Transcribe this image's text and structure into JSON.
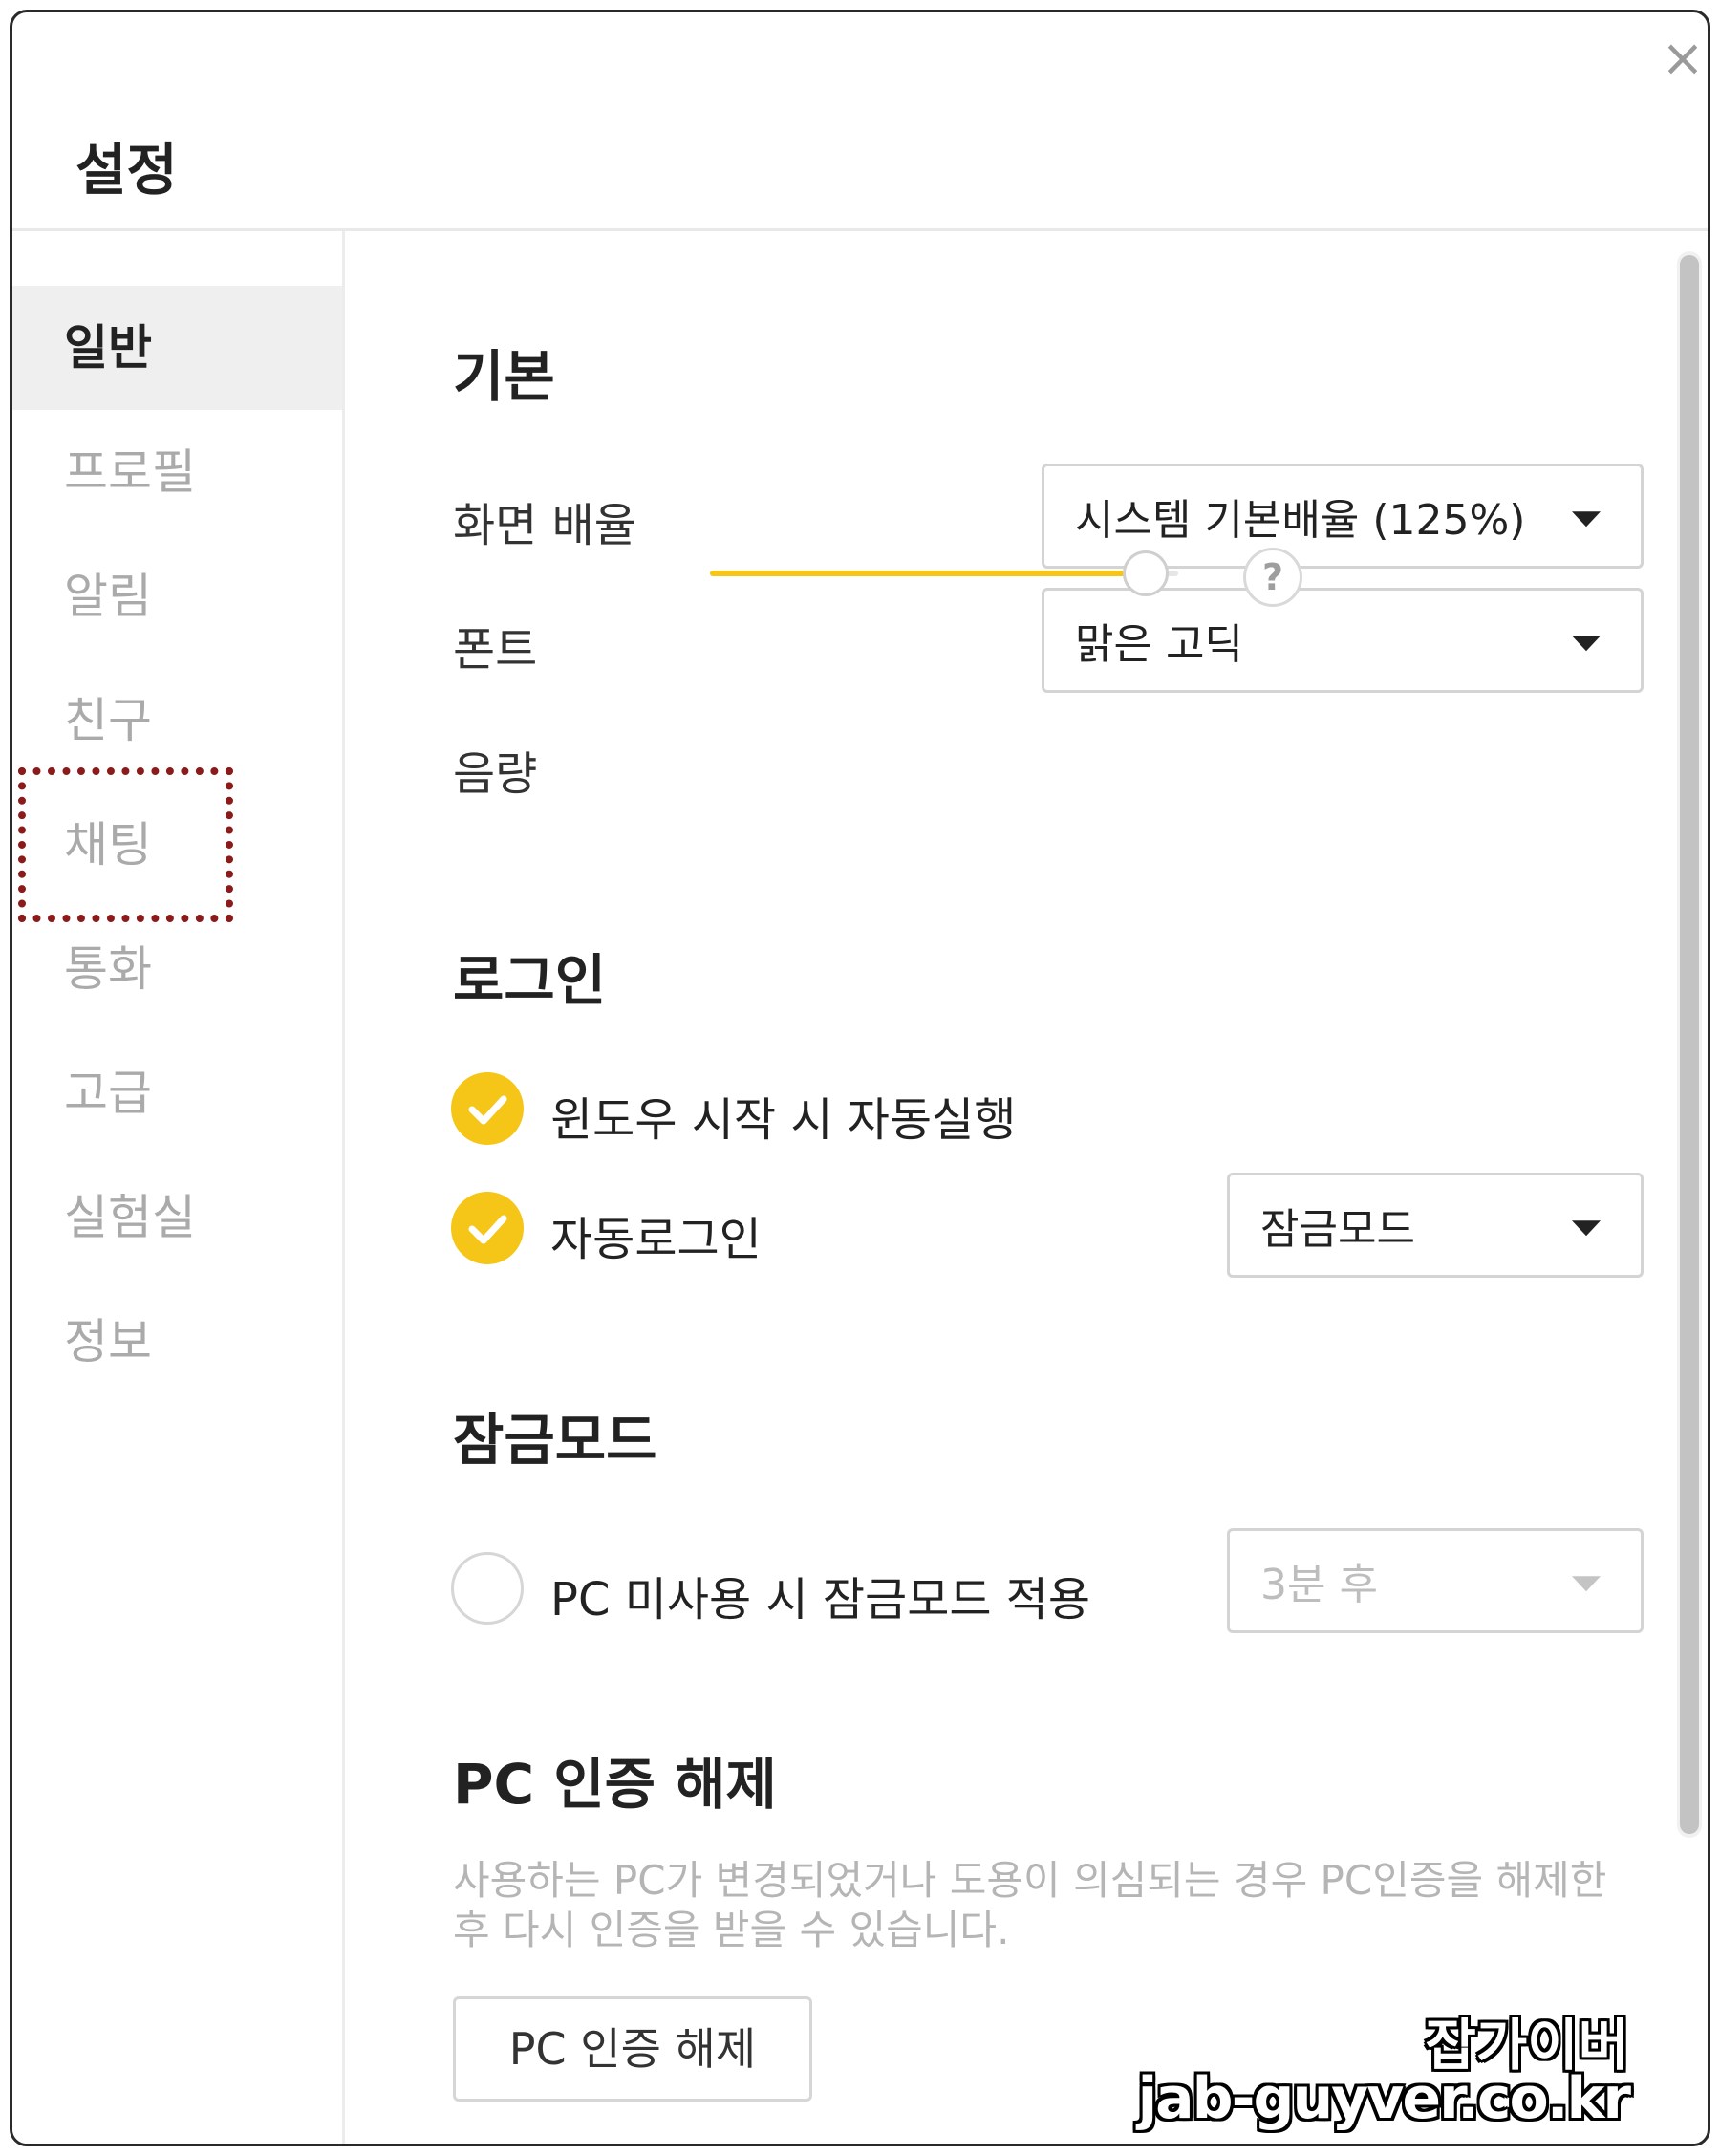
{
  "window": {
    "title": "설정",
    "close_glyph": "×"
  },
  "sidebar": {
    "items": [
      {
        "label": "일반",
        "active": true
      },
      {
        "label": "프로필"
      },
      {
        "label": "알림"
      },
      {
        "label": "친구"
      },
      {
        "label": "채팅"
      },
      {
        "label": "통화"
      },
      {
        "label": "고급"
      },
      {
        "label": "실험실"
      },
      {
        "label": "정보"
      }
    ]
  },
  "basic": {
    "title": "기본",
    "zoom": {
      "label": "화면 배율",
      "value": "시스템 기본배율 (125%)"
    },
    "font": {
      "label": "폰트",
      "value": "맑은 고딕"
    },
    "volume": {
      "label": "음량",
      "level": 0.93
    },
    "help_glyph": "?"
  },
  "login": {
    "title": "로그인",
    "autostart": {
      "label": "윈도우 시작 시 자동실행",
      "checked": true
    },
    "autologin": {
      "label": "자동로그인",
      "checked": true,
      "mode": "잠금모드"
    }
  },
  "lockmode": {
    "title": "잠금모드",
    "idle": {
      "label": "PC 미사용 시 잠금모드 적용",
      "checked": false,
      "delay": "3분 후"
    }
  },
  "pc_auth": {
    "title": "PC 인증 해제",
    "description": "사용하는 PC가 변경되었거나 도용이 의심되는 경우 PC인증을 해제한 후 다시 인증을 받을 수 있습니다.",
    "button_label": "PC 인증 해제"
  },
  "watermark": {
    "line1": "잡가이버",
    "line2": "jab-guyver.co.kr"
  },
  "colors": {
    "accent": "#f5c518",
    "highlight_border": "#8b1a1a",
    "active_bg": "#efefef"
  }
}
